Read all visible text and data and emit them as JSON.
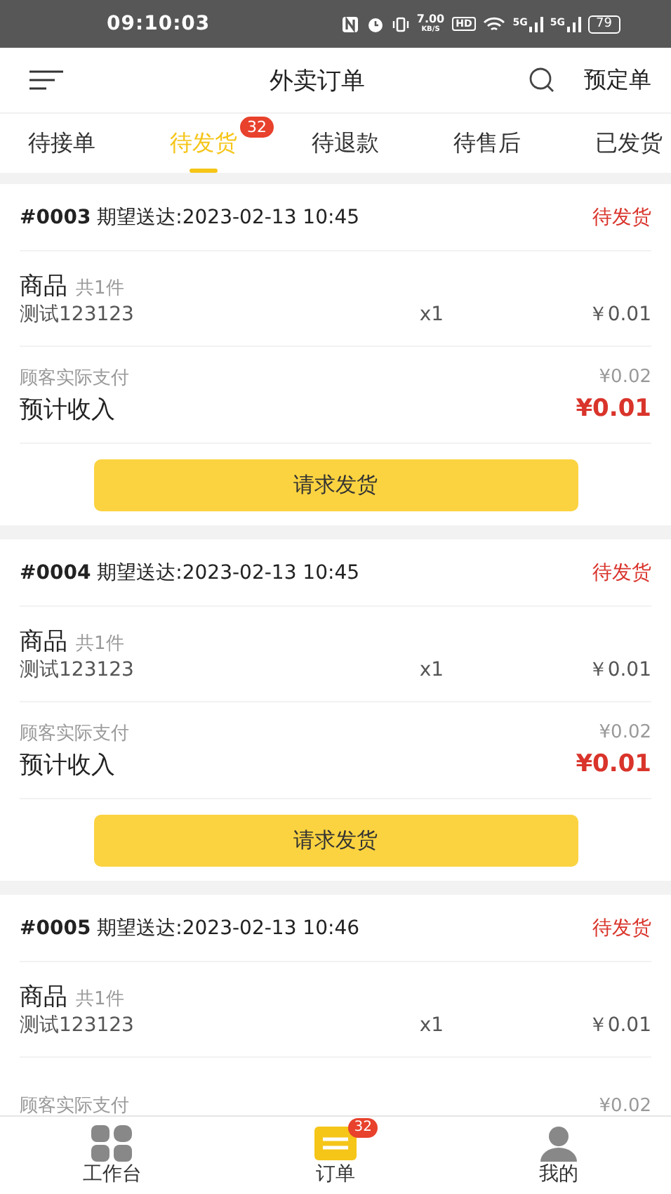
{
  "status_bar": {
    "time": "09:10:03",
    "speed": "7.00",
    "speed_unit": "KB/S",
    "hd": "HD",
    "signals": [
      "5G",
      "5G"
    ],
    "battery": "79"
  },
  "header": {
    "title": "外卖订单",
    "action": "预定单"
  },
  "tabs": [
    {
      "label": "待接单",
      "selected": false
    },
    {
      "label": "待发货",
      "selected": true,
      "badge": "32"
    },
    {
      "label": "待退款",
      "selected": false
    },
    {
      "label": "待售后",
      "selected": false
    },
    {
      "label": "已发货",
      "selected": false
    }
  ],
  "orders": [
    {
      "number": "#0003",
      "expected": "期望送达:2023-02-13 10:45",
      "status": "待发货",
      "goods_label": "商品",
      "goods_count": "共1件",
      "item": "测试123123",
      "qty": "x1",
      "price": "￥0.01",
      "paid_label": "顾客实际支付",
      "paid": "¥0.02",
      "income_label": "预计收入",
      "income": "¥0.01",
      "button": "请求发货"
    },
    {
      "number": "#0004",
      "expected": "期望送达:2023-02-13 10:45",
      "status": "待发货",
      "goods_label": "商品",
      "goods_count": "共1件",
      "item": "测试123123",
      "qty": "x1",
      "price": "￥0.01",
      "paid_label": "顾客实际支付",
      "paid": "¥0.02",
      "income_label": "预计收入",
      "income": "¥0.01",
      "button": "请求发货"
    },
    {
      "number": "#0005",
      "expected": "期望送达:2023-02-13 10:46",
      "status": "待发货",
      "goods_label": "商品",
      "goods_count": "共1件",
      "item": "测试123123",
      "qty": "x1",
      "price": "￥0.01",
      "paid_label": "顾客实际支付",
      "paid": "¥0.02"
    }
  ],
  "bottom_nav": [
    {
      "label": "工作台",
      "kind": "grid",
      "selected": false
    },
    {
      "label": "订单",
      "kind": "orders",
      "selected": true,
      "badge": "32"
    },
    {
      "label": "我的",
      "kind": "person",
      "selected": false
    }
  ]
}
